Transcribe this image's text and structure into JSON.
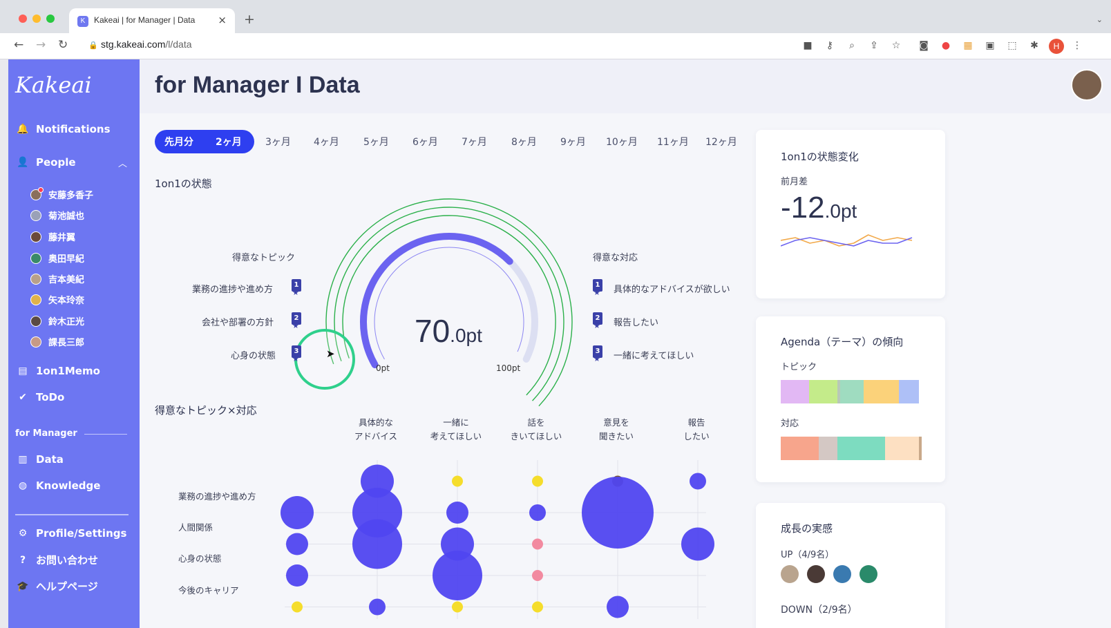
{
  "browser": {
    "tab_title": "Kakeai | for Manager | Data",
    "tab_icon": "K",
    "url_host": "stg.kakeai.com",
    "url_path": "/l/data",
    "profile_initial": "H"
  },
  "sidebar": {
    "logo": "Kakeai",
    "notifications": "Notifications",
    "people": "People",
    "people_members": [
      "安藤多香子",
      "菊池誠也",
      "藤井翼",
      "奥田早紀",
      "吉本美紀",
      "矢本玲奈",
      "鈴木正光",
      "課長三郎"
    ],
    "memo": "1on1Memo",
    "todo": "ToDo",
    "section_for_manager": "for Manager",
    "data": "Data",
    "knowledge": "Knowledge",
    "profile": "Profile/Settings",
    "contact": "お問い合わせ",
    "help": "ヘルプページ"
  },
  "header": {
    "title": "for Manager I Data"
  },
  "periods": [
    "先月分",
    "2ヶ月",
    "3ヶ月",
    "4ヶ月",
    "5ヶ月",
    "6ヶ月",
    "7ヶ月",
    "8ヶ月",
    "9ヶ月",
    "10ヶ月",
    "11ヶ月",
    "12ヶ月"
  ],
  "status": {
    "title": "1on1の状態",
    "topics_title": "得意なトピック",
    "topics": [
      "業務の進捗や進め方",
      "会社や部署の方針",
      "心身の状態"
    ],
    "responses_title": "得意な対応",
    "responses": [
      "具体的なアドバイスが欲しい",
      "報告したい",
      "一緒に考えてほしい"
    ],
    "ranks": [
      "1",
      "2",
      "3"
    ],
    "score": "70",
    "score_unit": ".0pt",
    "score_value": 70,
    "min_label": "0pt",
    "max_label": "100pt"
  },
  "matrix": {
    "title": "得意なトピック×対応",
    "columns": [
      [
        "具体的な",
        "アドバイス"
      ],
      [
        "一緒に",
        "考えてほしい"
      ],
      [
        "話を",
        "きいてほしい"
      ],
      [
        "意見を",
        "聞きたい"
      ],
      [
        "報告",
        "したい"
      ]
    ],
    "rows": [
      "業務の進捗や進め方",
      "人間関係",
      "心身の状態",
      "今後のキャリア"
    ],
    "bubbles": [
      {
        "row": -1,
        "col": 0,
        "size": 3,
        "color": "blue"
      },
      {
        "row": -1,
        "col": 1,
        "size": 1,
        "color": "yellow"
      },
      {
        "row": -1,
        "col": 2,
        "size": 1,
        "color": "yellow"
      },
      {
        "row": -1,
        "col": 3,
        "size": 1,
        "color": "brown"
      },
      {
        "row": -1,
        "col": 4,
        "size": 1.5,
        "color": "blue"
      },
      {
        "row": 0,
        "col": -1,
        "size": 3,
        "color": "blue"
      },
      {
        "row": 0,
        "col": 0,
        "size": 4.5,
        "color": "blue"
      },
      {
        "row": 0,
        "col": 1,
        "size": 2,
        "color": "blue"
      },
      {
        "row": 0,
        "col": 2,
        "size": 1.5,
        "color": "blue"
      },
      {
        "row": 0,
        "col": 3,
        "size": 6.5,
        "color": "blue"
      },
      {
        "row": 1,
        "col": -1,
        "size": 2,
        "color": "blue"
      },
      {
        "row": 1,
        "col": 0,
        "size": 4.5,
        "color": "blue"
      },
      {
        "row": 1,
        "col": 1,
        "size": 3,
        "color": "blue"
      },
      {
        "row": 1,
        "col": 2,
        "size": 1,
        "color": "pink"
      },
      {
        "row": 1,
        "col": 4,
        "size": 3,
        "color": "blue"
      },
      {
        "row": 2,
        "col": -1,
        "size": 2,
        "color": "blue"
      },
      {
        "row": 2,
        "col": 1,
        "size": 4.5,
        "color": "blue"
      },
      {
        "row": 2,
        "col": 2,
        "size": 1,
        "color": "pink"
      },
      {
        "row": 3,
        "col": -1,
        "size": 1,
        "color": "yellow"
      },
      {
        "row": 3,
        "col": 0,
        "size": 1.5,
        "color": "blue"
      },
      {
        "row": 3,
        "col": 1,
        "size": 1,
        "color": "yellow"
      },
      {
        "row": 3,
        "col": 2,
        "size": 1,
        "color": "yellow"
      },
      {
        "row": 3,
        "col": 3,
        "size": 2,
        "color": "blue"
      }
    ]
  },
  "change_card": {
    "title": "1on1の状態変化",
    "label": "前月差",
    "value": "-12",
    "unit": ".0pt",
    "spark_a": [
      5,
      6,
      4,
      5,
      3,
      4,
      7,
      5,
      6,
      5
    ],
    "spark_b": [
      3,
      5,
      6,
      5,
      4,
      3,
      5,
      4,
      4,
      6
    ]
  },
  "agenda_card": {
    "title": "Agenda（テーマ）の傾向",
    "topic_label": "トピック",
    "response_label": "対応",
    "topic_segments": [
      {
        "w": 20,
        "c": "#e2b8f4"
      },
      {
        "w": 20,
        "c": "#c4eb8a"
      },
      {
        "w": 2,
        "c": "#b8c8b8"
      },
      {
        "w": 17,
        "c": "#9fdcc0"
      },
      {
        "w": 25,
        "c": "#fbd27a"
      },
      {
        "w": 14,
        "c": "#aec0f7"
      }
    ],
    "response_segments": [
      {
        "w": 27,
        "c": "#f7a58c"
      },
      {
        "w": 13,
        "c": "#d4c8c4"
      },
      {
        "w": 34,
        "c": "#7ddcc0"
      },
      {
        "w": 24,
        "c": "#fde0c2"
      },
      {
        "w": 2,
        "c": "#c9a98a"
      }
    ]
  },
  "growth_card": {
    "title": "成長の実感",
    "up_label": "UP（4/9名）",
    "down_label": "DOWN（2/9名）"
  },
  "colors": {
    "accent": "#6d76f2",
    "pill": "#2e3ff0",
    "bubble_blue": "#5046f0",
    "bubble_yellow": "#f5dd2c",
    "bubble_pink": "#f28aa0",
    "bubble_brown": "#7a5a2a"
  }
}
